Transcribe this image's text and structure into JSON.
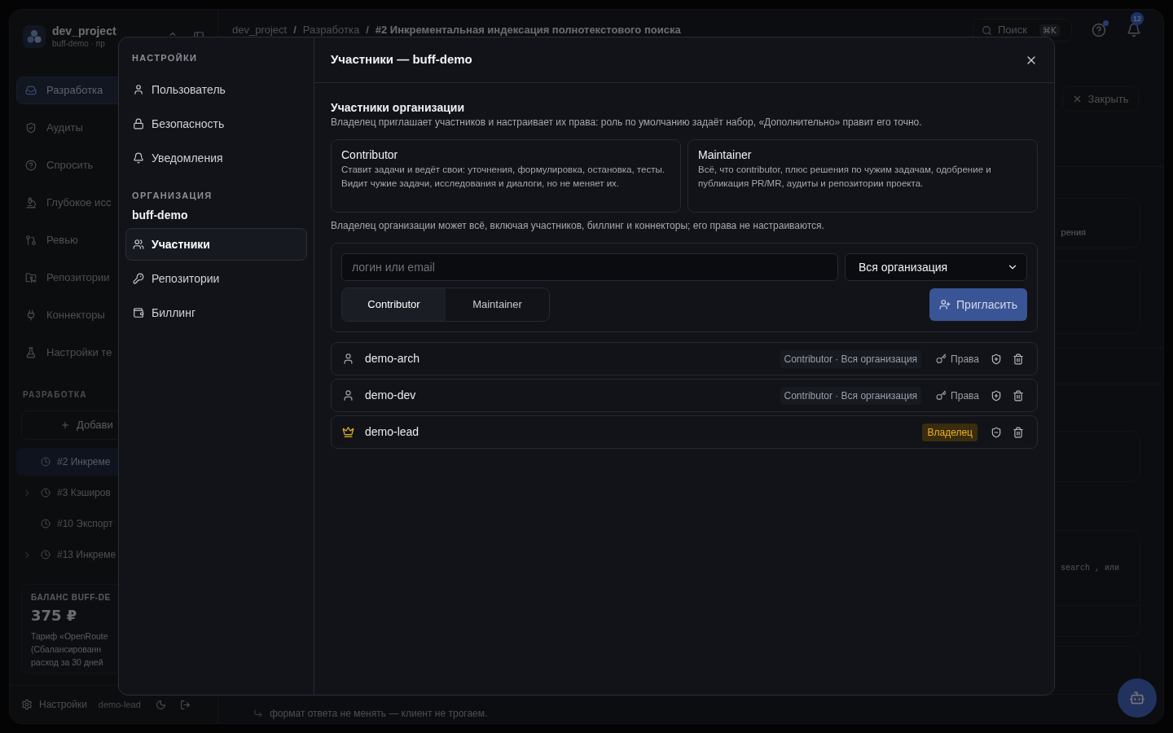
{
  "app": {
    "sidebar": {
      "project": {
        "name": "dev_project",
        "subtitle": "buff-demo · пр"
      },
      "nav": [
        {
          "label": "Разработка",
          "selected": true
        },
        {
          "label": "Аудиты",
          "selected": false
        },
        {
          "label": "Спросить",
          "selected": false
        },
        {
          "label": "Глубокое исс",
          "selected": false
        },
        {
          "label": "Ревью",
          "selected": false
        },
        {
          "label": "Репозитории",
          "selected": false
        },
        {
          "label": "Коннекторы",
          "selected": false
        },
        {
          "label": "Настройки те",
          "selected": false
        }
      ],
      "section_title": "РАЗРАБОТКА",
      "add_button": "Добави",
      "tasks": [
        {
          "label": "#2 Инкреме",
          "selected": true,
          "expandable": false
        },
        {
          "label": "#3 Кэширов",
          "selected": false,
          "expandable": true
        },
        {
          "label": "#10 Экспорт",
          "selected": false,
          "expandable": false
        },
        {
          "label": "#13 Инкреме",
          "selected": false,
          "expandable": true
        }
      ],
      "balance": {
        "title": "БАЛАНС BUFF-DE",
        "amount": "375 ₽",
        "lines": [
          "Тариф «OpenRoute",
          "(Сбалансированн",
          "расход за 30 дней"
        ]
      },
      "footer": {
        "settings": "Настройки",
        "user": "demo-lead"
      }
    },
    "topbar": {
      "breadcrumb": [
        {
          "kind": "link",
          "label": "dev_project"
        },
        {
          "kind": "separator",
          "label": "/"
        },
        {
          "kind": "link",
          "label": "Разработка"
        },
        {
          "kind": "separator",
          "label": "/"
        },
        {
          "kind": "current",
          "label": "#2 Инкрементальная индексация полнотекстового поиска"
        }
      ],
      "search": {
        "label": "Поиск",
        "shortcut": "⌘K"
      },
      "notifications": "12"
    },
    "panel": {
      "close_button": "Закрыть",
      "card_text_1": "рения",
      "card_text_2": "search , или"
    },
    "composer_hint": "формат ответа не менять — клиент не трогаем."
  },
  "dialog": {
    "nav": {
      "sections": [
        {
          "title": "НАСТРОЙКИ",
          "items": [
            {
              "label": "Пользователь",
              "selected": false
            },
            {
              "label": "Безопасность",
              "selected": false
            },
            {
              "label": "Уведомления",
              "selected": false
            }
          ]
        },
        {
          "title": "ОРГАНИЗАЦИЯ",
          "org": "buff-demo",
          "items": [
            {
              "label": "Участники",
              "selected": true
            },
            {
              "label": "Репозитории",
              "selected": false
            },
            {
              "label": "Биллинг",
              "selected": false
            }
          ]
        }
      ]
    },
    "title": "Участники — buff-demo",
    "section": {
      "title": "Участники организации",
      "description": "Владелец приглашает участников и настраивает их права: роль по умолчанию задаёт набор, «Дополнительно» правит его точно."
    },
    "roles": [
      {
        "name": "Contributor",
        "description": "Ставит задачи и ведёт свои: уточнения, формулировка, остановка, тесты. Видит чужие задачи, исследования и диалоги, но не меняет их."
      },
      {
        "name": "Maintainer",
        "description": "Всё, что contributor, плюс решения по чужим задачам, одобрение и публикация PR/MR, аудиты и репозитории проекта."
      }
    ],
    "owner_note": "Владелец организации может всё, включая участников, биллинг и коннекторы; его права не настраиваются.",
    "invite": {
      "login": {
        "placeholder": "логин или email"
      },
      "scope": {
        "value": "Вся организация"
      },
      "role_options": [
        {
          "label": "Contributor",
          "selected": true
        },
        {
          "label": "Maintainer",
          "selected": false
        }
      ],
      "submit": "Пригласить"
    },
    "members": [
      {
        "kind": "member",
        "name": "demo-arch",
        "role": "Contributor · Вся организация",
        "rights_button": "Права"
      },
      {
        "kind": "member",
        "name": "demo-dev",
        "role": "Contributor · Вся организация",
        "rights_button": "Права"
      },
      {
        "kind": "owner",
        "name": "demo-lead",
        "badge": "Владелец"
      }
    ]
  }
}
